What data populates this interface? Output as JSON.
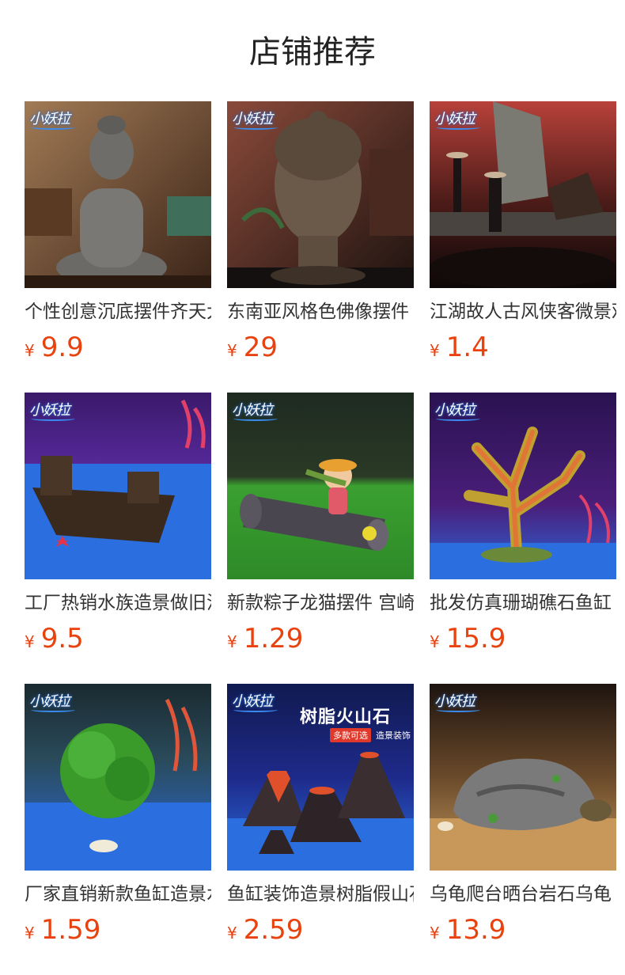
{
  "page": {
    "title": "店铺推荐"
  },
  "brand": {
    "logo_text": "小妖拉"
  },
  "products": [
    {
      "name": "个性创意沉底摆件齐天大圣",
      "currency": "¥",
      "price": "9.9",
      "image": "monkey-king-statue"
    },
    {
      "name": "东南亚风格色佛像摆件",
      "currency": "¥",
      "price": "29",
      "image": "buddha-head"
    },
    {
      "name": "江湖故人古风侠客微景观",
      "currency": "¥",
      "price": "1.4",
      "image": "wuxia-figures"
    },
    {
      "name": "工厂热销水族造景做旧沉船",
      "currency": "¥",
      "price": "9.5",
      "image": "shipwreck"
    },
    {
      "name": "新款粽子龙猫摆件 宫崎骏",
      "currency": "¥",
      "price": "1.29",
      "image": "girl-on-log"
    },
    {
      "name": "批发仿真珊瑚礁石鱼缸",
      "currency": "¥",
      "price": "15.9",
      "image": "coral"
    },
    {
      "name": "厂家直销新款鱼缸造景水草",
      "currency": "¥",
      "price": "1.59",
      "image": "aquatic-grass-ball"
    },
    {
      "name": "鱼缸装饰造景树脂假山石",
      "currency": "¥",
      "price": "2.59",
      "image": "volcano-rocks",
      "overlay_title": "树脂火山石",
      "overlay_tag": "多款可选",
      "overlay_sub": "造景装饰"
    },
    {
      "name": "乌龟爬台晒台岩石乌龟",
      "currency": "¥",
      "price": "13.9",
      "image": "turtle-rock"
    }
  ]
}
